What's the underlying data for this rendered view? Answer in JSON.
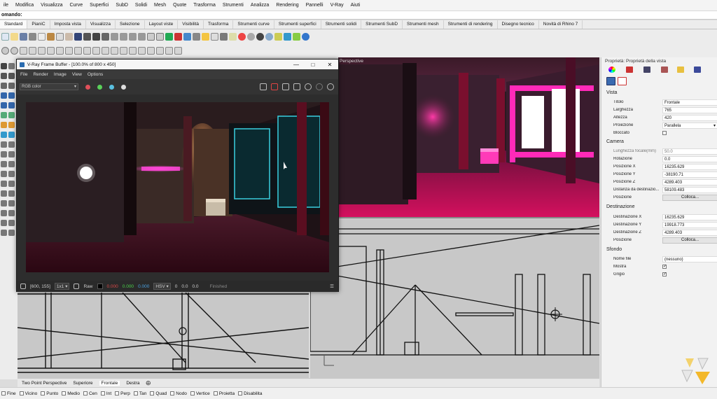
{
  "menu": [
    "ile",
    "Modifica",
    "Visualizza",
    "Curve",
    "Superfici",
    "SubD",
    "Solidi",
    "Mesh",
    "Quote",
    "Trasforma",
    "Strumenti",
    "Analizza",
    "Rendering",
    "Pannelli",
    "V-Ray",
    "Aiuti"
  ],
  "command": {
    "label": "omando:"
  },
  "toolbar_tabs": [
    "Standard",
    "PianiC",
    "Imposta vista",
    "Visualizza",
    "Selezione",
    "Layout viste",
    "Visibilità",
    "Trasforma",
    "Strumenti curve",
    "Strumenti superfici",
    "Strumenti solidi",
    "Strumenti SubD",
    "Strumenti mesh",
    "Strumenti di rendering",
    "Disegno tecnico",
    "Novità di Rhino 7"
  ],
  "active_toolbar_tab": "Standard",
  "vray": {
    "title": "V-Ray Frame Buffer - [100.0% of 800 x 450]",
    "menu": [
      "File",
      "Render",
      "Image",
      "View",
      "Options"
    ],
    "channel": "RGB color",
    "status": {
      "coords": "[600, 155]",
      "zoom": "1x1",
      "raw_label": "Raw",
      "r": "0.000",
      "g": "0.000",
      "b": "0.000",
      "mode": "HSV",
      "v1": "0",
      "v2": "0.0",
      "v3": "0.0",
      "state": "Finished"
    }
  },
  "viewport_label": "Perspective",
  "viewport_tabs": [
    "Two Point Perspective",
    "Superiore",
    "Frontale",
    "Destra"
  ],
  "active_viewport_tab": "Frontale",
  "properties": {
    "title": "Proprietà: Proprietà della vista",
    "sections": {
      "vista": "Vista",
      "camera": "Camera",
      "destinazione": "Destinazione",
      "sfondo": "Sfondo"
    },
    "vista_rows": [
      {
        "label": "Titolo",
        "value": "Frontale"
      },
      {
        "label": "Larghezza",
        "value": "765"
      },
      {
        "label": "Altezza",
        "value": "420"
      },
      {
        "label": "Proiezione",
        "value": "Parallela"
      },
      {
        "label": "Bloccato",
        "value": ""
      }
    ],
    "camera_rows": [
      {
        "label": "Lunghezza focale(mm)",
        "value": "50.0"
      },
      {
        "label": "Rotazione",
        "value": "0.0"
      },
      {
        "label": "Posizione X",
        "value": "16235.629"
      },
      {
        "label": "Posizione Y",
        "value": "-38190.71"
      },
      {
        "label": "Posizione Z",
        "value": "4289.403"
      },
      {
        "label": "Distanza da destinazio...",
        "value": "58109.483"
      },
      {
        "label": "Posizione",
        "button": "Colloca..."
      }
    ],
    "destinazione_rows": [
      {
        "label": "Destinazione X",
        "value": "16235.629"
      },
      {
        "label": "Destinazione Y",
        "value": "19918.773"
      },
      {
        "label": "Destinazione Z",
        "value": "4289.403"
      },
      {
        "label": "Posizione",
        "button": "Colloca..."
      }
    ],
    "sfondo_rows": [
      {
        "label": "Nome file",
        "value": "(nessuno)"
      },
      {
        "label": "Mostra",
        "checked": true
      },
      {
        "label": "Grigio",
        "checked": true
      }
    ]
  },
  "osnaps": [
    "Fine",
    "Vicino",
    "Punto",
    "Medio",
    "Cen",
    "Int",
    "Perp",
    "Tan",
    "Quad",
    "Nodo",
    "Vertice",
    "Proietta",
    "Disabilita"
  ],
  "colors": {
    "accent_magenta": "#ff1aa8",
    "render_bg": "#140a0e",
    "viewport_gray": "#c8c8c8"
  }
}
